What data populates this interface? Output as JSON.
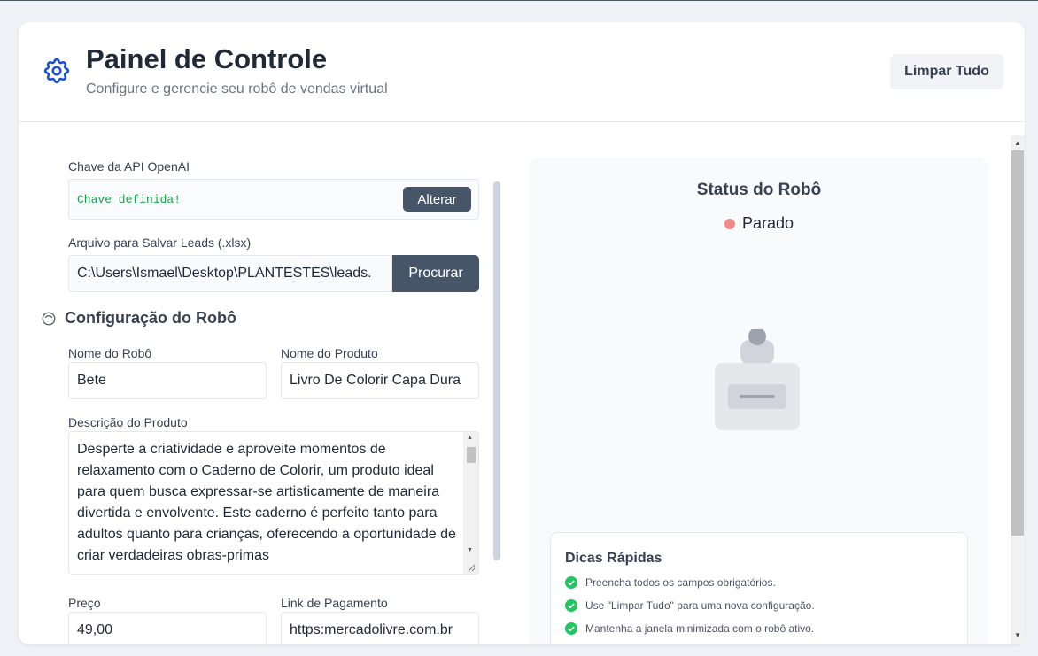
{
  "header": {
    "title": "Painel de Controle",
    "subtitle": "Configure e gerencie seu robô de vendas virtual",
    "clear_button": "Limpar Tudo",
    "icon": "gear-icon"
  },
  "api": {
    "label": "Chave da API OpenAI",
    "value": "Chave definida!",
    "change_button": "Alterar"
  },
  "file": {
    "label": "Arquivo para Salvar Leads (.xlsx)",
    "value": "C:\\Users\\Ismael\\Desktop\\PLANTESTES\\leads.",
    "browse_button": "Procurar"
  },
  "robot_config": {
    "title": "Configuração do Robô",
    "robot_name_label": "Nome do Robô",
    "robot_name": "Bete",
    "product_name_label": "Nome do Produto",
    "product_name": "Livro De Colorir Capa Dura",
    "description_label": "Descrição do Produto",
    "description": "Desperte a criatividade e aproveite momentos de relaxamento com o Caderno de Colorir, um produto ideal para quem busca expressar-se artisticamente de maneira divertida e envolvente. Este caderno é perfeito tanto para adultos quanto para crianças, oferecendo a oportunidade de criar verdadeiras obras-primas",
    "price_label": "Preço",
    "price": "49,00",
    "payment_link_label": "Link de Pagamento",
    "payment_link": "https:mercadolivre.com.br"
  },
  "status": {
    "title": "Status do Robô",
    "state": "Parado",
    "state_color": "#f08a8a"
  },
  "tips": {
    "title": "Dicas Rápidas",
    "items": [
      "Preencha todos os campos obrigatórios.",
      "Use \"Limpar Tudo\" para uma nova configuração.",
      "Mantenha a janela minimizada com o robô ativo."
    ]
  },
  "colors": {
    "accent": "#1d4ed8",
    "button_dark": "#475569",
    "success": "#16a34a"
  }
}
